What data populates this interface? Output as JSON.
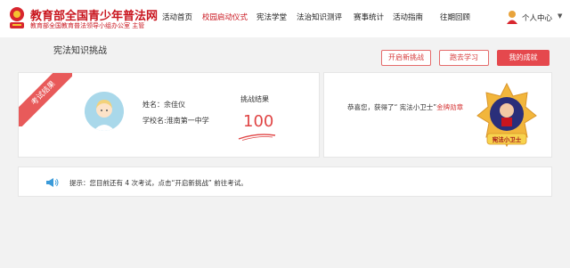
{
  "brand": {
    "title": "教育部全国青少年普法网",
    "subtitle": "教育部全国教育普法领导小组办公室 主管"
  },
  "nav": {
    "items": [
      {
        "label": "活动首页",
        "active": false
      },
      {
        "label": "校园启动仪式",
        "active": true
      },
      {
        "label": "宪法学堂",
        "active": false
      },
      {
        "label": "法治知识测评",
        "active": false
      },
      {
        "label": "赛事统计",
        "active": false
      },
      {
        "label": "活动指南",
        "active": false
      },
      {
        "label": "往期回顾",
        "active": false
      }
    ],
    "user_label": "个人中心",
    "user_caret": "▼"
  },
  "page": {
    "title": "宪法知识挑战"
  },
  "actions": {
    "new_challenge": "开启新挑战",
    "study": "跑去学习",
    "my_results": "我的成就"
  },
  "result": {
    "ribbon": "考试结果",
    "name_label": "姓名：余佳仪",
    "school_label": "学校名:淮南第一中学",
    "score_label": "挑战结果",
    "score": "100"
  },
  "award": {
    "prefix": "恭喜您，获得了“ 宪法小卫士”",
    "highlight": "金牌勋章",
    "medal_text": "宪法小卫士"
  },
  "tip": {
    "text": "提示：您目前还有 4 次考试，点击“开启新挑战” 前往考试。"
  },
  "colors": {
    "brand_red": "#c9151e",
    "accent_red": "#e5484d",
    "score_red": "#e04545",
    "medal_gold": "#f2b63c",
    "avatar_bg": "#a9d8ea",
    "page_bg": "#f2f2f2"
  }
}
